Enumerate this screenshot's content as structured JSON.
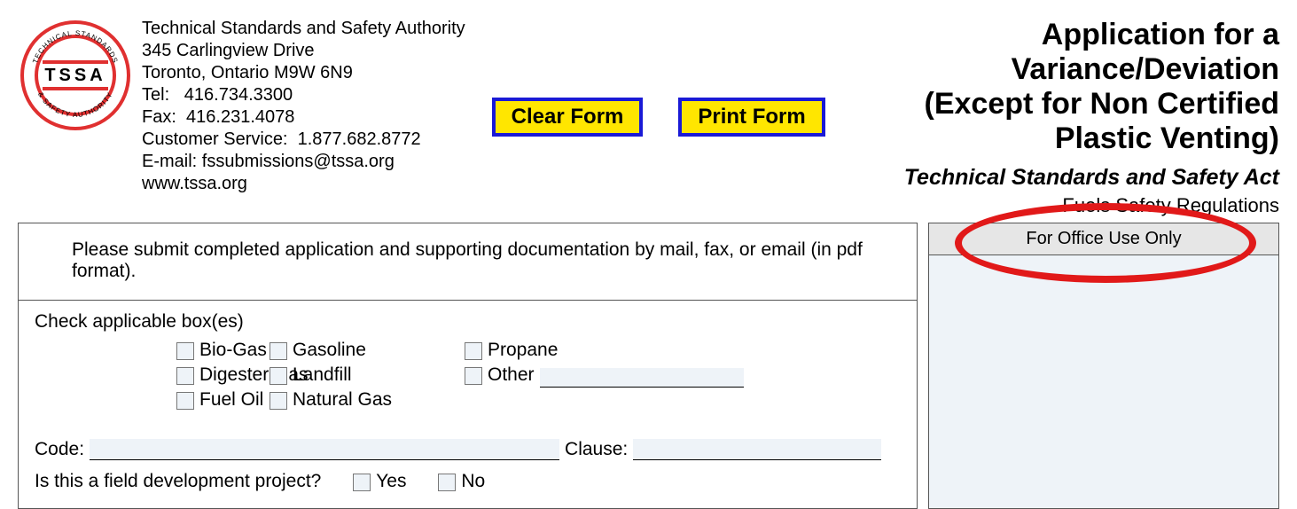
{
  "org": {
    "name": "Technical Standards and Safety Authority",
    "addr1": "345 Carlingview Drive",
    "addr2": "Toronto, Ontario  M9W 6N9",
    "tel_label": "Tel:",
    "tel": "416.734.3300",
    "fax_label": "Fax:",
    "fax": "416.231.4078",
    "cs_label": "Customer Service:",
    "cs": "1.877.682.8772",
    "email_label": "E-mail:",
    "email": "fssubmissions@tssa.org",
    "web": "www.tssa.org",
    "logo_text": "T S S A",
    "logo_top": "TECHNICAL STANDARDS",
    "logo_bottom": "& SAFETY AUTHORITY"
  },
  "buttons": {
    "clear": "Clear Form",
    "print": "Print Form"
  },
  "title": {
    "line1": "Application for a Variance/Deviation",
    "line2": "(Except for Non Certified Plastic Venting)",
    "sub1": "Technical Standards and Safety Act",
    "sub2": "Fuels Safety Regulations"
  },
  "form": {
    "instructions": "Please submit completed application and supporting documentation by mail, fax, or email (in pdf format).",
    "check_label": "Check applicable box(es)",
    "options": {
      "biogas": "Bio-Gas",
      "digester": "Digester Gas",
      "fueloil": "Fuel Oil",
      "gasoline": "Gasoline",
      "landfill": "Landfill",
      "naturalgas": "Natural Gas",
      "propane": "Propane",
      "other": "Other"
    },
    "code_label": "Code:",
    "clause_label": "Clause:",
    "field_dev_label": "Is this a field development project?",
    "yes": "Yes",
    "no": "No"
  },
  "office": {
    "header": "For Office Use Only"
  }
}
